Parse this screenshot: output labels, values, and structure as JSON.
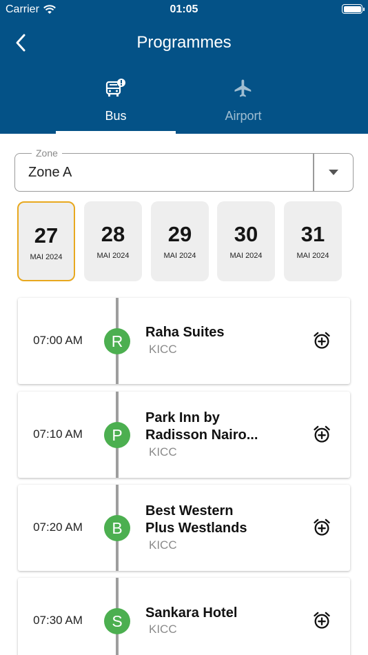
{
  "status_bar": {
    "carrier": "Carrier",
    "time": "01:05"
  },
  "header": {
    "title": "Programmes",
    "back_icon": "chevron-left-icon"
  },
  "tabs": [
    {
      "label": "Bus",
      "icon": "bus-alert-icon",
      "active": true
    },
    {
      "label": "Airport",
      "icon": "airplane-icon",
      "active": false
    }
  ],
  "zone": {
    "legend": "Zone",
    "value": "Zone A"
  },
  "dates": [
    {
      "day": "27",
      "month": "MAI 2024",
      "selected": true
    },
    {
      "day": "28",
      "month": "MAI 2024",
      "selected": false
    },
    {
      "day": "29",
      "month": "MAI 2024",
      "selected": false
    },
    {
      "day": "30",
      "month": "MAI 2024",
      "selected": false
    },
    {
      "day": "31",
      "month": "MAI 2024",
      "selected": false
    }
  ],
  "stops": [
    {
      "time": "07:00 AM",
      "initial": "R",
      "name_lines": [
        "Raha Suites"
      ],
      "destination": "KICC"
    },
    {
      "time": "07:10 AM",
      "initial": "P",
      "name_lines": [
        "Park Inn by",
        "Radisson Nairo..."
      ],
      "destination": "KICC"
    },
    {
      "time": "07:20 AM",
      "initial": "B",
      "name_lines": [
        "Best Western",
        "Plus Westlands"
      ],
      "destination": "KICC"
    },
    {
      "time": "07:30 AM",
      "initial": "S",
      "name_lines": [
        "Sankara Hotel"
      ],
      "destination": "KICC"
    }
  ],
  "colors": {
    "header_bg": "#045287",
    "selected_date_border": "#e8a81e",
    "stop_circle": "#4caf50",
    "timeline": "#9e9e9e"
  }
}
